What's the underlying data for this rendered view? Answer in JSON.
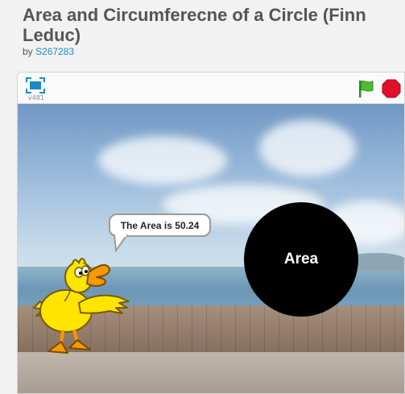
{
  "project": {
    "title": "Area and Circumferecne of a Circle (Finn Leduc)",
    "by_label": "by",
    "author": "S267283"
  },
  "player": {
    "version": "v481",
    "icons": {
      "fullscreen": "fullscreen-icon",
      "flag": "green-flag-icon",
      "stop": "stop-sign-icon"
    },
    "colors": {
      "flag": "#4cbf2f",
      "stop": "#e0102a"
    }
  },
  "stage": {
    "speech_bubble": "The Area is 50.24",
    "circle_label": "Area"
  }
}
